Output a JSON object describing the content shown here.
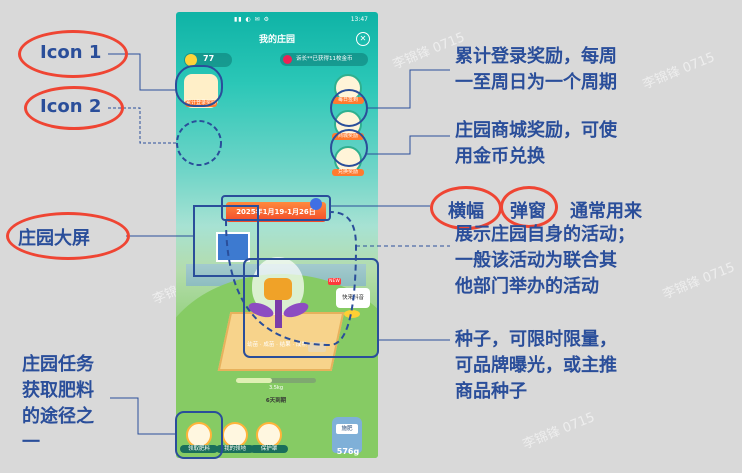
{
  "app": {
    "title": "我的庄园",
    "status_time": "13:47",
    "coins": "77",
    "notice": "诉长**已获得11枚金币",
    "left_icon_label": "累计登录奖励",
    "right_icons": [
      "每日签到",
      "商城奖励",
      "兑换奖励"
    ],
    "banner_text": "2025年1月19-1月26日",
    "new_tag": "NEW",
    "harvest_label": "快来抖音",
    "stages": "幼苗 · 成苗 · 结果 · 成熟",
    "progress_pct": 45,
    "progress_text": "3.5kg",
    "days_left": "6天到期",
    "bottom_buttons": [
      "领取肥料",
      "我的领地",
      "保护罩"
    ],
    "bag_label": "施肥",
    "bag_amount": "576g",
    "watermark": "李锦锋 0715"
  },
  "annotations": {
    "icon1": "Icon 1",
    "icon2": "Icon 2",
    "big_screen": "庄园大屏",
    "banner_word": "横幅",
    "popup_word": "弹窗",
    "tasks": [
      "庄园任务",
      "获取肥料",
      "的途径之",
      "一"
    ],
    "login_reward": [
      "累计登录奖励，每周",
      "一至周日为一个周期"
    ],
    "shop_reward": [
      "庄园商城奖励，可使",
      "用金币兑换"
    ],
    "banner_desc_suffix": "通常用来",
    "banner_desc": [
      "展示庄园自身的活动；",
      "一般该活动为联合其",
      "他部门举办的活动"
    ],
    "seed_desc": [
      "种子，可限时限量，",
      "可品牌曝光，或主推",
      "商品种子"
    ]
  },
  "colors": {
    "annotation_text": "#2a4e9a",
    "highlight_ellipse": "#ef4533",
    "phone_sky": "#2bc7b7",
    "phone_grass": "#79c262"
  }
}
